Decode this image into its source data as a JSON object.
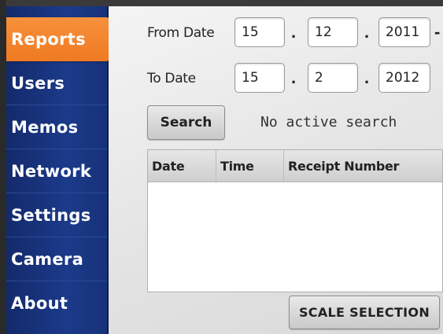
{
  "sidebar": {
    "items": [
      {
        "label": "Reports",
        "active": true
      },
      {
        "label": "Users",
        "active": false
      },
      {
        "label": "Memos",
        "active": false
      },
      {
        "label": "Network",
        "active": false
      },
      {
        "label": "Settings",
        "active": false
      },
      {
        "label": "Camera",
        "active": false
      },
      {
        "label": "About",
        "active": false
      }
    ]
  },
  "filters": {
    "from_label": "From Date",
    "from_day": "15",
    "from_month": "12",
    "from_year": "2011",
    "to_label": "To Date",
    "to_day": "15",
    "to_month": "2",
    "to_year": "2012",
    "separator": ".",
    "trailing_dash": "-"
  },
  "search": {
    "button_label": "Search",
    "status": "No active search"
  },
  "table": {
    "columns": [
      "Date",
      "Time",
      "Receipt Number"
    ],
    "rows": []
  },
  "footer": {
    "scale_selection_label": "SCALE SELECTION"
  },
  "colors": {
    "sidebar": "#1b3a8a",
    "active_tab": "#f7913c"
  }
}
